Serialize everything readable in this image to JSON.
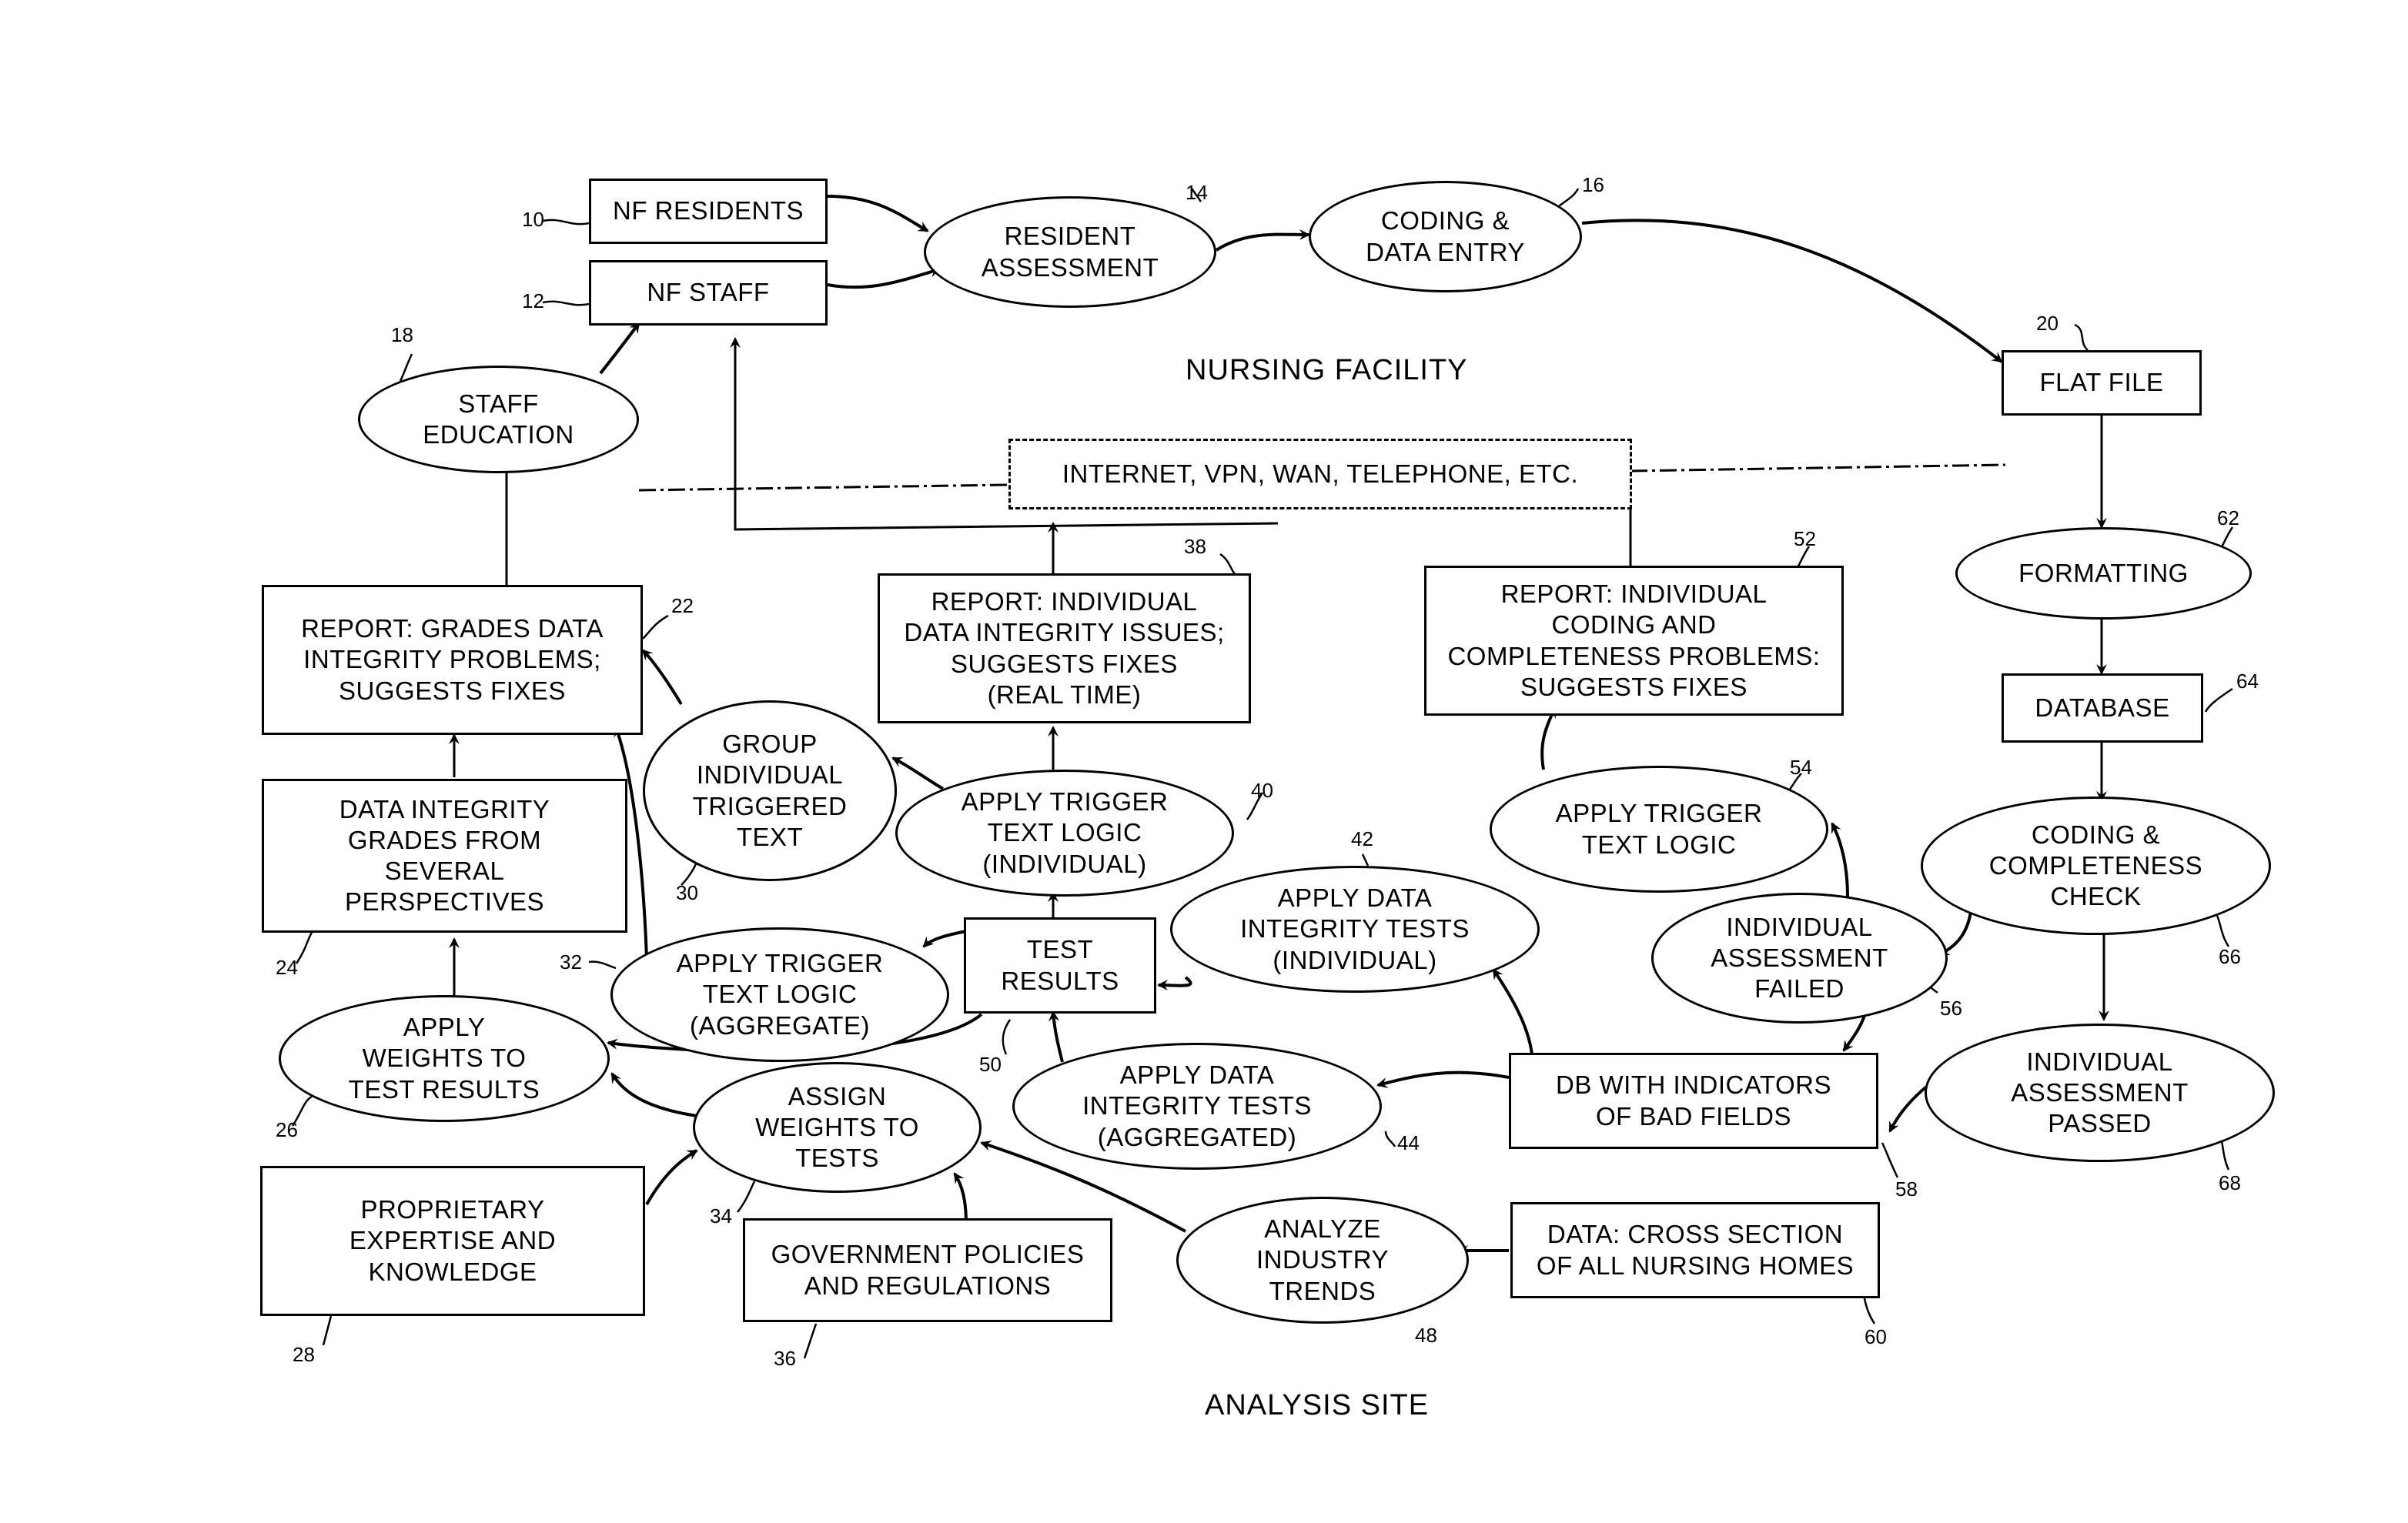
{
  "regions": {
    "top": "NURSING FACILITY",
    "bottom": "ANALYSIS SITE"
  },
  "nodes": {
    "nf_residents": {
      "ref": "10",
      "label": "NF RESIDENTS"
    },
    "nf_staff": {
      "ref": "12",
      "label": "NF STAFF"
    },
    "resident_assessment": {
      "ref": "14",
      "label": "RESIDENT\nASSESSMENT"
    },
    "coding_data_entry": {
      "ref": "16",
      "label": "CODING &\nDATA ENTRY"
    },
    "staff_education": {
      "ref": "18",
      "label": "STAFF\nEDUCATION"
    },
    "flat_file": {
      "ref": "20",
      "label": "FLAT FILE"
    },
    "network": {
      "label": "INTERNET, VPN, WAN, TELEPHONE, ETC."
    },
    "report_grades": {
      "ref": "22",
      "label": "REPORT: GRADES DATA\nINTEGRITY PROBLEMS;\nSUGGESTS FIXES"
    },
    "grades_perspectives": {
      "ref": "24",
      "label": "DATA INTEGRITY\nGRADES FROM\nSEVERAL\nPERSPECTIVES"
    },
    "apply_weights": {
      "ref": "26",
      "label": "APPLY\nWEIGHTS TO\nTEST RESULTS"
    },
    "proprietary": {
      "ref": "28",
      "label": "PROPRIETARY\nEXPERTISE AND\nKNOWLEDGE"
    },
    "group_triggered": {
      "ref": "30",
      "label": "GROUP\nINDIVIDUAL\nTRIGGERED\nTEXT"
    },
    "trigger_aggregate": {
      "ref": "32",
      "label": "APPLY TRIGGER\nTEXT LOGIC\n(AGGREGATE)"
    },
    "assign_weights": {
      "ref": "34",
      "label": "ASSIGN\nWEIGHTS TO\nTESTS"
    },
    "gov_policies": {
      "ref": "36",
      "label": "GOVERNMENT POLICIES\nAND REGULATIONS"
    },
    "report_individual_integrity": {
      "ref": "38",
      "label": "REPORT: INDIVIDUAL\nDATA INTEGRITY ISSUES;\nSUGGESTS FIXES\n(REAL TIME)"
    },
    "trigger_individual": {
      "ref": "40",
      "label": "APPLY TRIGGER\nTEXT LOGIC\n(INDIVIDUAL)"
    },
    "integrity_individual": {
      "ref": "42",
      "label": "APPLY DATA\nINTEGRITY TESTS\n(INDIVIDUAL)"
    },
    "integrity_aggregated": {
      "ref": "44",
      "label": "APPLY DATA\nINTEGRITY TESTS\n(AGGREGATED)"
    },
    "industry_trends": {
      "ref": "48",
      "label": "ANALYZE\nINDUSTRY\nTRENDS"
    },
    "test_results": {
      "ref": "50",
      "label": "TEST\nRESULTS"
    },
    "report_coding": {
      "ref": "52",
      "label": "REPORT: INDIVIDUAL\nCODING AND\nCOMPLETENESS PROBLEMS:\nSUGGESTS FIXES"
    },
    "trigger_text": {
      "ref": "54",
      "label": "APPLY TRIGGER\nTEXT LOGIC"
    },
    "assessment_failed": {
      "ref": "56",
      "label": "INDIVIDUAL\nASSESSMENT\nFAILED"
    },
    "db_bad_fields": {
      "ref": "58",
      "label": "DB WITH INDICATORS\nOF BAD FIELDS"
    },
    "cross_section": {
      "ref": "60",
      "label": "DATA: CROSS SECTION\nOF ALL NURSING HOMES"
    },
    "formatting": {
      "ref": "62",
      "label": "FORMATTING"
    },
    "database": {
      "ref": "64",
      "label": "DATABASE"
    },
    "coding_check": {
      "ref": "66",
      "label": "CODING &\nCOMPLETENESS\nCHECK"
    },
    "assessment_passed": {
      "ref": "68",
      "label": "INDIVIDUAL\nASSESSMENT\nPASSED"
    }
  }
}
